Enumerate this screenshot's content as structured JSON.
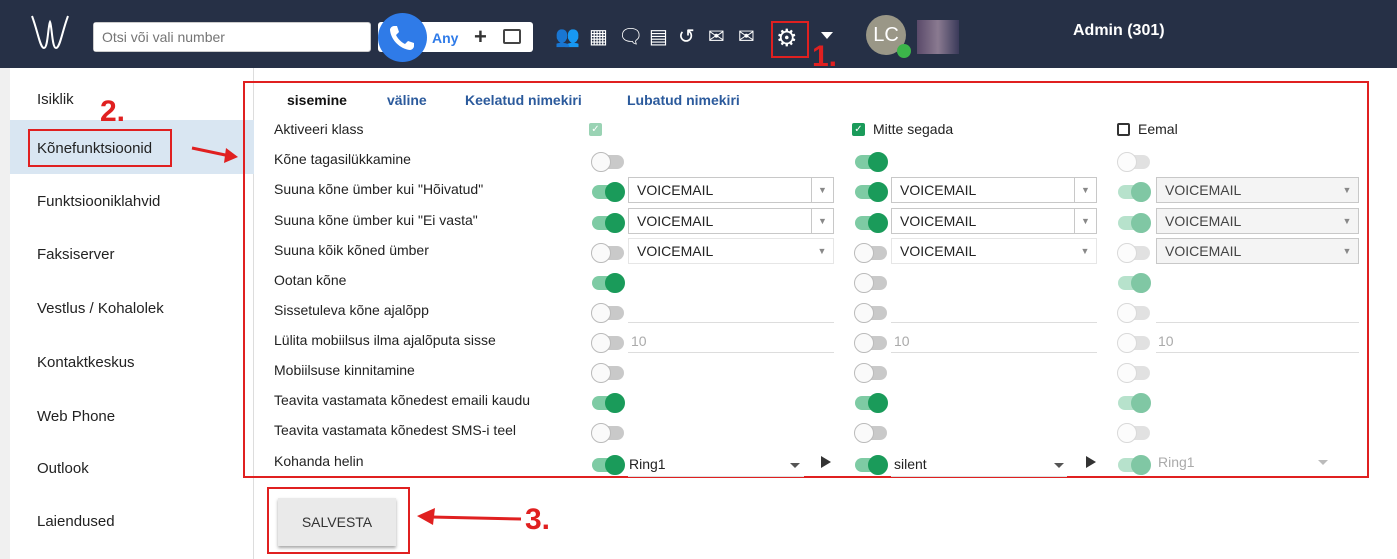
{
  "header": {
    "search_placeholder": "Otsi või vali number",
    "dial_mode": "Any",
    "user": "Admin (301)",
    "avatar_initials": "LC"
  },
  "annotations": {
    "step1": "1.",
    "step2": "2.",
    "step3": "3."
  },
  "sidebar": {
    "items": [
      {
        "label": "Isiklik"
      },
      {
        "label": "Kõnefunktsioonid"
      },
      {
        "label": "Funktsiooniklahvid"
      },
      {
        "label": "Faksiserver"
      },
      {
        "label": "Vestlus / Kohalolek"
      },
      {
        "label": "Kontaktkeskus"
      },
      {
        "label": "Web Phone"
      },
      {
        "label": "Outlook"
      },
      {
        "label": "Laiendused"
      }
    ]
  },
  "tabs": [
    {
      "label": "sisemine",
      "active": true
    },
    {
      "label": "väline"
    },
    {
      "label": "Keelatud nimekiri"
    },
    {
      "label": "Lubatud nimekiri"
    }
  ],
  "columns": [
    {
      "status_label": ""
    },
    {
      "status_label": "Mitte segada"
    },
    {
      "status_label": "Eemal"
    }
  ],
  "rows": [
    {
      "label": "Aktiveeri klass"
    },
    {
      "label": "Kõne tagasilükkamine"
    },
    {
      "label": "Suuna kõne ümber kui \"Hõivatud\""
    },
    {
      "label": "Suuna kõne ümber kui \"Ei vasta\""
    },
    {
      "label": "Suuna kõik kõned ümber"
    },
    {
      "label": "Ootan kõne"
    },
    {
      "label": "Sissetuleva kõne ajalõpp"
    },
    {
      "label": "Lülita mobiilsus ilma ajalõputa sisse"
    },
    {
      "label": "Mobiilsuse kinnitamine"
    },
    {
      "label": "Teavita vastamata kõnedest emaili kaudu"
    },
    {
      "label": "Teavita vastamata kõnedest SMS-i teel"
    },
    {
      "label": "Kohanda helin"
    }
  ],
  "values": {
    "voicemail": "VOICEMAIL",
    "mobility_timeout": "10",
    "ring_col1": "Ring1",
    "ring_col2": "silent",
    "ring_col3": "Ring1"
  },
  "save_label": "SALVESTA",
  "colors": {
    "accent": "#1a9b5a",
    "highlight": "#e02020",
    "topbar": "#263046"
  }
}
